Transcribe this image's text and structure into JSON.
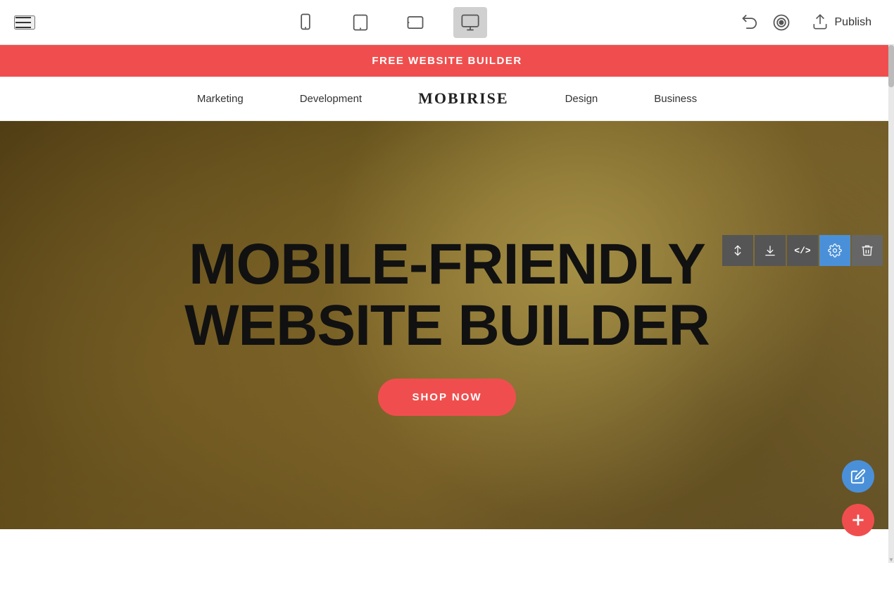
{
  "toolbar": {
    "publish_label": "Publish",
    "devices": [
      {
        "id": "mobile",
        "label": "Mobile"
      },
      {
        "id": "tablet",
        "label": "Tablet"
      },
      {
        "id": "tablet-landscape",
        "label": "Tablet Landscape"
      },
      {
        "id": "desktop",
        "label": "Desktop"
      }
    ]
  },
  "promo_banner": {
    "text": "FREE WEBSITE BUILDER"
  },
  "nav": {
    "items": [
      {
        "label": "Marketing"
      },
      {
        "label": "Development"
      },
      {
        "label": "Design"
      },
      {
        "label": "Business"
      }
    ],
    "logo": "MOBIRISE"
  },
  "hero": {
    "title_line1": "MOBILE-FRIENDLY",
    "title_line2": "WEBSITE BUILDER",
    "cta_label": "SHOP NOW"
  },
  "section_toolbar": {
    "buttons": [
      {
        "id": "move",
        "label": "↕"
      },
      {
        "id": "download",
        "label": "↓"
      },
      {
        "id": "code",
        "label": "</>"
      },
      {
        "id": "settings",
        "label": "⚙"
      },
      {
        "id": "delete",
        "label": "🗑"
      }
    ]
  }
}
